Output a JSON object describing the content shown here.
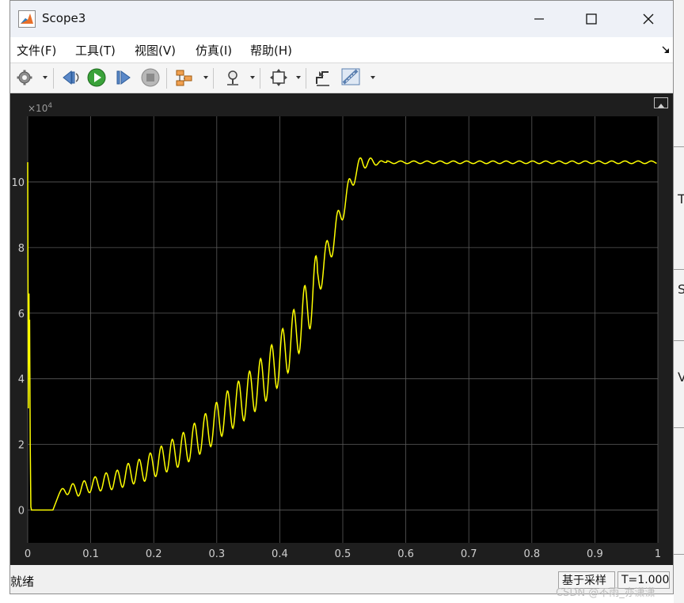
{
  "window": {
    "title": "Scope3"
  },
  "menu": [
    "文件(F)",
    "工具(T)",
    "视图(V)",
    "仿真(I)",
    "帮助(H)"
  ],
  "toolbar": {
    "icons": [
      "settings-icon",
      "step-back-icon",
      "run-icon",
      "step-forward-icon",
      "stop-icon",
      "highlight-block-icon",
      "zoom-icon",
      "autoscale-icon",
      "triggers-icon",
      "measurements-icon"
    ]
  },
  "plot": {
    "exponent_base": "×10",
    "exponent_power": "4"
  },
  "status": {
    "left": "就绪",
    "mode": "基于采样",
    "time": "T=1.000"
  },
  "watermark": "CSDN @不雨_亦潇潇",
  "background_letters": [
    "T",
    "S",
    "V"
  ],
  "colors": {
    "trace": "#ffff00",
    "plot_bg": "#000000",
    "panel_bg": "#1e1e1e",
    "grid": "#5a5a5a"
  },
  "chart_data": {
    "type": "line",
    "title": "",
    "xlabel": "",
    "ylabel": "",
    "xlim": [
      0,
      1
    ],
    "ylim": [
      -1.0,
      12.0
    ],
    "y_scale_note": "×10^4",
    "x_ticks": [
      "0",
      "0.1",
      "0.2",
      "0.3",
      "0.4",
      "0.5",
      "0.6",
      "0.7",
      "0.8",
      "0.9",
      "1"
    ],
    "y_ticks": [
      "0",
      "2",
      "4",
      "6",
      "8",
      "10"
    ],
    "grid": true,
    "series": [
      {
        "color": "#ffff00",
        "x": [
          0,
          0.001,
          0.002,
          0.0025,
          0.003,
          0.004,
          0.005,
          0.006,
          0.008,
          0.01,
          0.02,
          0.03,
          0.04,
          0.05,
          0.06,
          0.07,
          0.08,
          0.09,
          0.1,
          0.11,
          0.12,
          0.13,
          0.14,
          0.15,
          0.16,
          0.17,
          0.18,
          0.19,
          0.2,
          0.21,
          0.22,
          0.23,
          0.24,
          0.25,
          0.26,
          0.27,
          0.28,
          0.29,
          0.3,
          0.31,
          0.32,
          0.33,
          0.34,
          0.35,
          0.36,
          0.37,
          0.38,
          0.39,
          0.4,
          0.41,
          0.42,
          0.43,
          0.44,
          0.45,
          0.46,
          0.47,
          0.48,
          0.49,
          0.5,
          0.51,
          0.52,
          0.53,
          0.54,
          0.55,
          0.56,
          0.57,
          0.58,
          0.6,
          0.7,
          0.8,
          0.9,
          1.0
        ],
        "y": [
          10.6,
          3.1,
          6.6,
          4.5,
          5.8,
          2.0,
          0.1,
          0.0,
          0.0,
          0.0,
          0.0,
          0.0,
          0.0,
          0.5,
          0.6,
          0.65,
          0.6,
          0.7,
          0.75,
          0.8,
          0.85,
          0.9,
          0.9,
          1.0,
          1.1,
          1.15,
          1.2,
          1.3,
          1.4,
          1.5,
          1.6,
          1.7,
          1.8,
          1.9,
          2.05,
          2.2,
          2.35,
          2.5,
          2.7,
          2.9,
          3.05,
          3.2,
          3.35,
          3.5,
          3.7,
          3.9,
          4.1,
          4.35,
          4.6,
          4.9,
          5.2,
          5.6,
          6.0,
          6.5,
          7.0,
          7.5,
          8.0,
          8.6,
          9.2,
          9.8,
          10.3,
          10.6,
          10.6,
          10.6,
          10.6,
          10.6,
          10.6,
          10.6,
          10.6,
          10.6,
          10.6,
          10.6
        ]
      }
    ]
  }
}
